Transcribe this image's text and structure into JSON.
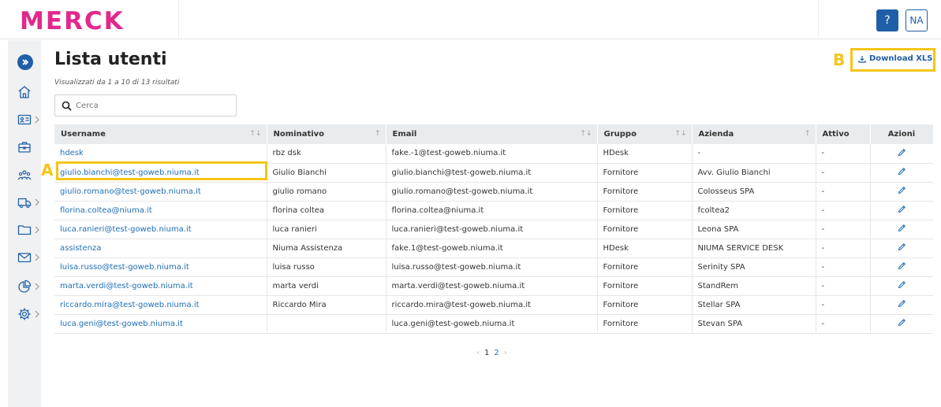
{
  "brand": {
    "logo_text": "MERCK",
    "logo_color": "#e2288a"
  },
  "header": {
    "help_label": "?",
    "avatar_initials": "NA"
  },
  "sidebar": {
    "items": [
      {
        "icon": "home-icon",
        "has_submenu": false
      },
      {
        "icon": "id-card-icon",
        "has_submenu": true
      },
      {
        "icon": "briefcase-icon",
        "has_submenu": false
      },
      {
        "icon": "users-icon",
        "has_submenu": false
      },
      {
        "icon": "truck-icon",
        "has_submenu": true
      },
      {
        "icon": "folder-icon",
        "has_submenu": true
      },
      {
        "icon": "mail-icon",
        "has_submenu": true
      },
      {
        "icon": "pie-chart-icon",
        "has_submenu": true
      },
      {
        "icon": "gear-icon",
        "has_submenu": true
      }
    ]
  },
  "page": {
    "title": "Lista utenti",
    "results_info": "Visualizzati da 1 a 10 di 13 risultati",
    "download_label": "Download XLS"
  },
  "search": {
    "placeholder": "Cerca",
    "value": ""
  },
  "annotations": {
    "label_a": "A",
    "label_b": "B",
    "highlight_color": "#f5c518"
  },
  "table": {
    "columns": [
      {
        "label": "Username",
        "sortable": true
      },
      {
        "label": "Nominativo",
        "sortable": true
      },
      {
        "label": "Email",
        "sortable": true
      },
      {
        "label": "Gruppo",
        "sortable": true
      },
      {
        "label": "Azienda",
        "sortable": true
      },
      {
        "label": "Attivo",
        "sortable": false
      },
      {
        "label": "Azioni",
        "sortable": false
      }
    ],
    "rows": [
      {
        "username": "hdesk",
        "nominativo": "rbz dsk",
        "email": "fake.-1@test-goweb.niuma.it",
        "gruppo": "HDesk",
        "azienda": "-",
        "attivo": "-"
      },
      {
        "username": "giulio.bianchi@test-goweb.niuma.it",
        "nominativo": "Giulio Bianchi",
        "email": "giulio.bianchi@test-goweb.niuma.it",
        "gruppo": "Fornitore",
        "azienda": "Avv. Giulio Bianchi",
        "attivo": "-"
      },
      {
        "username": "giulio.romano@test-goweb.niuma.it",
        "nominativo": "giulio romano",
        "email": "giulio.romano@test-goweb.niuma.it",
        "gruppo": "Fornitore",
        "azienda": "Colosseus SPA",
        "attivo": "-"
      },
      {
        "username": "florina.coltea@niuma.it",
        "nominativo": "florina coltea",
        "email": "florina.coltea@niuma.it",
        "gruppo": "Fornitore",
        "azienda": "fcoltea2",
        "attivo": "-"
      },
      {
        "username": "luca.ranieri@test-goweb.niuma.it",
        "nominativo": "luca ranieri",
        "email": "luca.ranieri@test-goweb.niuma.it",
        "gruppo": "Fornitore",
        "azienda": "Leona SPA",
        "attivo": "-"
      },
      {
        "username": "assistenza",
        "nominativo": "Niuma Assistenza",
        "email": "fake.1@test-goweb.niuma.it",
        "gruppo": "HDesk",
        "azienda": "NIUMA SERVICE DESK",
        "attivo": "-"
      },
      {
        "username": "luisa.russo@test-goweb.niuma.it",
        "nominativo": "luisa russo",
        "email": "luisa.russo@test-goweb.niuma.it",
        "gruppo": "Fornitore",
        "azienda": "Serinity SPA",
        "attivo": "-"
      },
      {
        "username": "marta.verdi@test-goweb.niuma.it",
        "nominativo": "marta verdi",
        "email": "marta.verdi@test-goweb.niuma.it",
        "gruppo": "Fornitore",
        "azienda": "StandRem",
        "attivo": "-"
      },
      {
        "username": "riccardo.mira@test-goweb.niuma.it",
        "nominativo": "Riccardo Mira",
        "email": "riccardo.mira@test-goweb.niuma.it",
        "gruppo": "Fornitore",
        "azienda": "Stellar SPA",
        "attivo": "-"
      },
      {
        "username": "luca.geni@test-goweb.niuma.it",
        "nominativo": "",
        "email": "luca.geni@test-goweb.niuma.it",
        "gruppo": "Fornitore",
        "azienda": "Stevan SPA",
        "attivo": "-"
      }
    ]
  },
  "pagination": {
    "pages": [
      "1",
      "2"
    ],
    "current": "1",
    "prev": "‹",
    "next": "›"
  }
}
